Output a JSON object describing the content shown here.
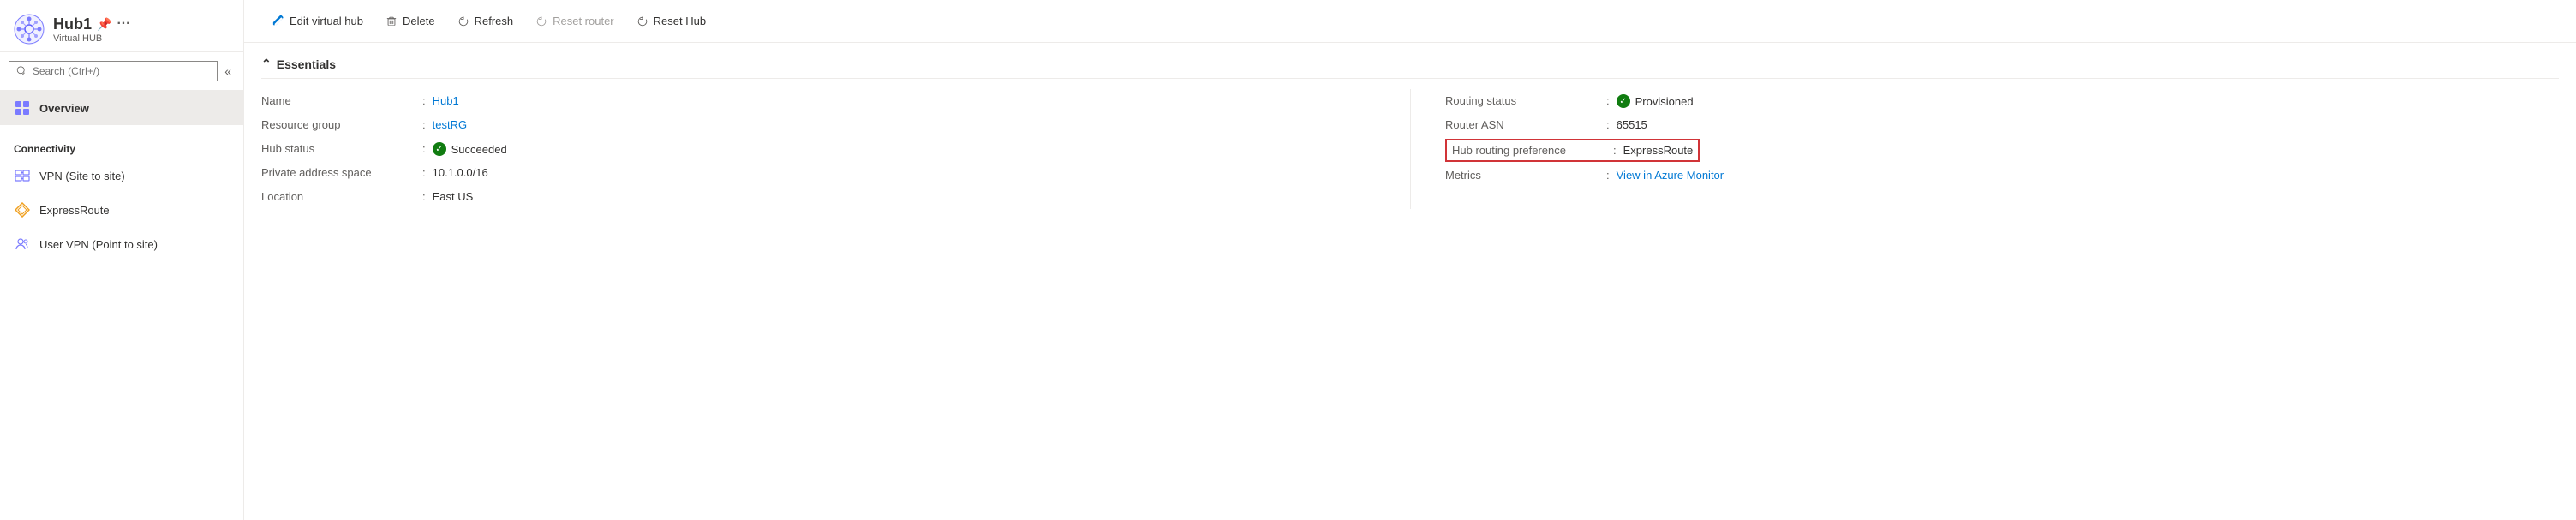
{
  "sidebar": {
    "hub_title": "Hub1",
    "hub_subtitle": "Virtual HUB",
    "search_placeholder": "Search (Ctrl+/)",
    "collapse_symbol": "«",
    "nav_items": [
      {
        "id": "overview",
        "label": "Overview",
        "active": true,
        "icon": "overview"
      }
    ],
    "connectivity_label": "Connectivity",
    "connectivity_items": [
      {
        "id": "vpn",
        "label": "VPN (Site to site)",
        "icon": "vpn"
      },
      {
        "id": "expressroute",
        "label": "ExpressRoute",
        "icon": "expressroute"
      },
      {
        "id": "uservpn",
        "label": "User VPN (Point to site)",
        "icon": "uservpn"
      }
    ]
  },
  "toolbar": {
    "edit_label": "Edit virtual hub",
    "delete_label": "Delete",
    "refresh_label": "Refresh",
    "reset_router_label": "Reset router",
    "reset_hub_label": "Reset Hub"
  },
  "essentials": {
    "header": "Essentials",
    "fields_left": [
      {
        "label": "Name",
        "value": "Hub1",
        "link": true
      },
      {
        "label": "Resource group",
        "value": "testRG",
        "link": true
      },
      {
        "label": "Hub status",
        "value": "Succeeded",
        "status_icon": true
      },
      {
        "label": "Private address space",
        "value": "10.1.0.0/16"
      },
      {
        "label": "Location",
        "value": "East US"
      }
    ],
    "fields_right": [
      {
        "label": "Routing status",
        "value": "Provisioned",
        "status_icon": true
      },
      {
        "label": "Router ASN",
        "value": "65515"
      },
      {
        "label": "Hub routing preference",
        "value": "ExpressRoute",
        "highlight": true
      },
      {
        "label": "Metrics",
        "value": "View in Azure Monitor",
        "link": true
      }
    ]
  }
}
